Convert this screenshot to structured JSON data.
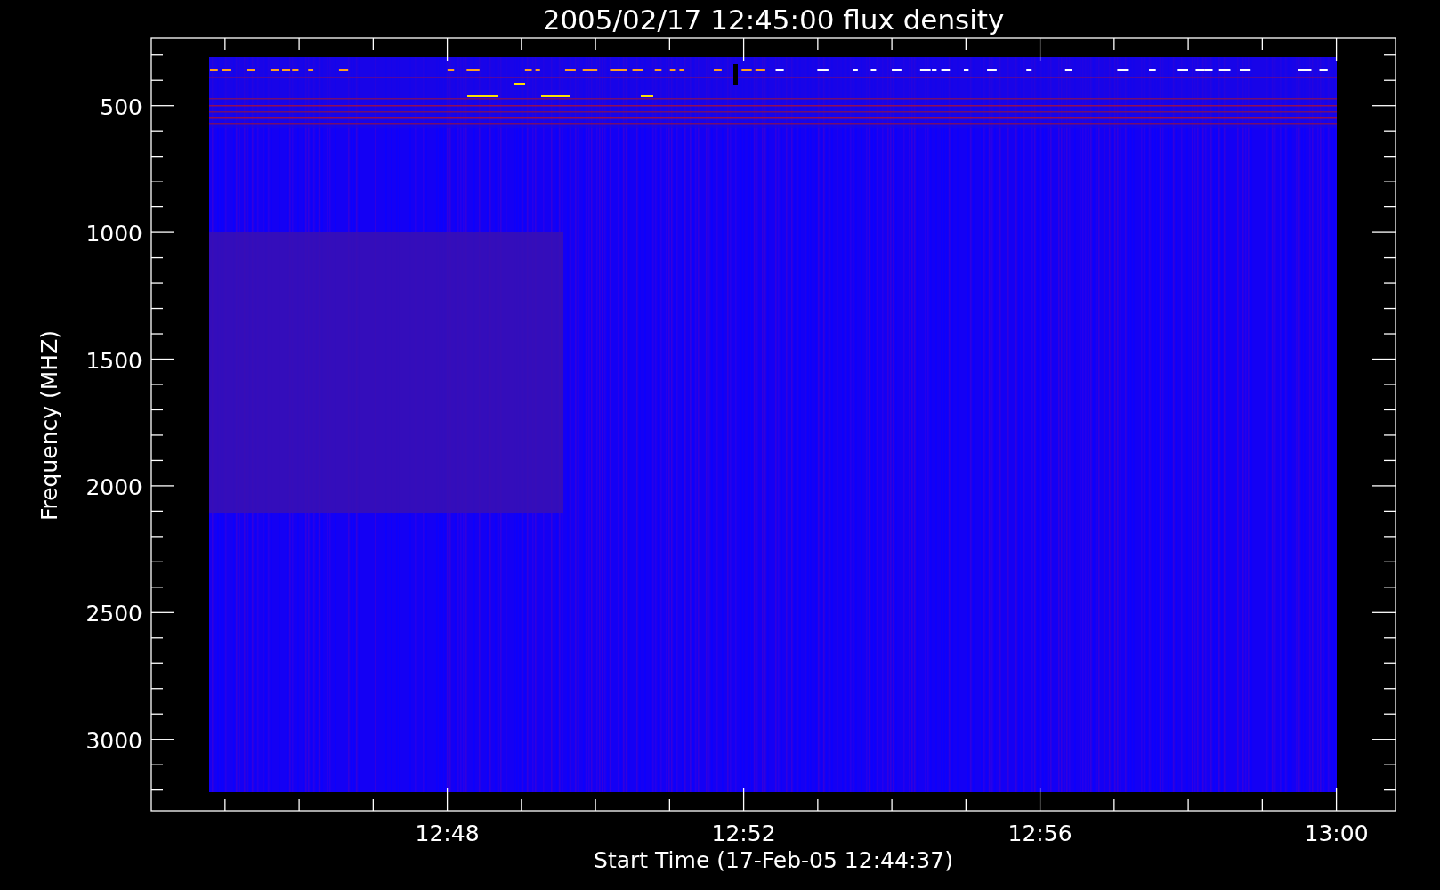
{
  "plot": {
    "title": "2005/02/17 12:45:00 flux density",
    "ylabel": "Frequency (MHZ)",
    "xlabel": "Start Time (17-Feb-05 12:44:37)",
    "yticks": [
      "500",
      "1000",
      "1500",
      "2000",
      "2500",
      "3000"
    ],
    "xticks": [
      "12:48",
      "12:52",
      "12:56",
      "13:00"
    ]
  }
}
